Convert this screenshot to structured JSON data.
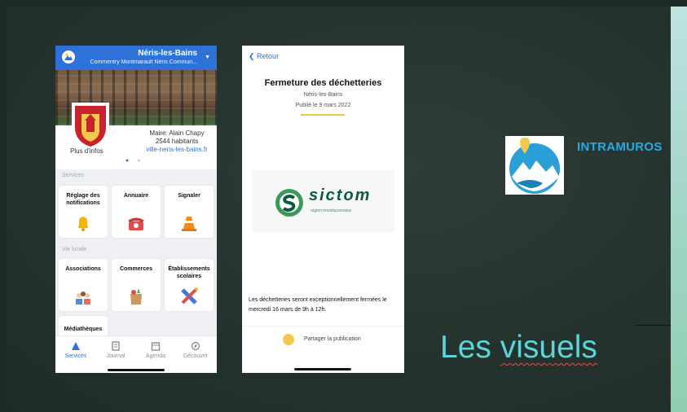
{
  "phone_app": {
    "city": "Néris-les-Bains",
    "communes": "Commentry Montmarault Néris Commun...",
    "maire": "Maire: Alain Chapy",
    "habitants": "2544 habitants",
    "website": "ville-neris-les-bains.fr",
    "plus_infos": "Plus d'infos",
    "sections": {
      "services": "Services",
      "vie_locale": "Vie locale"
    },
    "services_tiles": [
      {
        "label": "Réglage des notifications",
        "icon": "bell-icon"
      },
      {
        "label": "Annuaire",
        "icon": "phone-icon"
      },
      {
        "label": "Signaler",
        "icon": "traffic-cone-icon"
      }
    ],
    "vie_locale_tiles": [
      {
        "label": "Associations",
        "icon": "people-icon"
      },
      {
        "label": "Commerces",
        "icon": "grocery-bag-icon"
      },
      {
        "label": "Établissements scolaires",
        "icon": "pencil-ruler-icon"
      },
      {
        "label": "Médiathèques",
        "icon": "book-icon"
      }
    ],
    "tabs": [
      {
        "label": "Services",
        "icon": "services-icon",
        "active": true
      },
      {
        "label": "Journal",
        "icon": "newspaper-icon",
        "active": false
      },
      {
        "label": "Agenda",
        "icon": "calendar-icon",
        "active": false
      },
      {
        "label": "Découvrir",
        "icon": "compass-icon",
        "active": false
      }
    ],
    "colors": {
      "accent": "#2e72d9",
      "bell": "#f4b400",
      "phone": "#e04b4b",
      "cone": "#f28c1b"
    }
  },
  "phone_article": {
    "back": "Retour",
    "title": "Fermeture des déchetteries",
    "location": "Néris-les-Bains",
    "published": "Publié le 9 mars 2022",
    "logo_text": "sictom",
    "logo_region": "région montluçonnaise",
    "body": "Les déchetteries seront exceptionnellement fermées le mercredi 16 mars de 9h à 12h.",
    "share": "Partager la publication",
    "colors": {
      "accent": "#f2c94c",
      "logo": "#0b5c3b"
    }
  },
  "brand": {
    "name": "INTRAMUROS",
    "logo_icon": "intramuros-logo-icon",
    "color": "#29a9e1"
  },
  "slide_title": {
    "part1": "Les ",
    "part2": "visuels",
    "color": "#5fd3d7"
  }
}
